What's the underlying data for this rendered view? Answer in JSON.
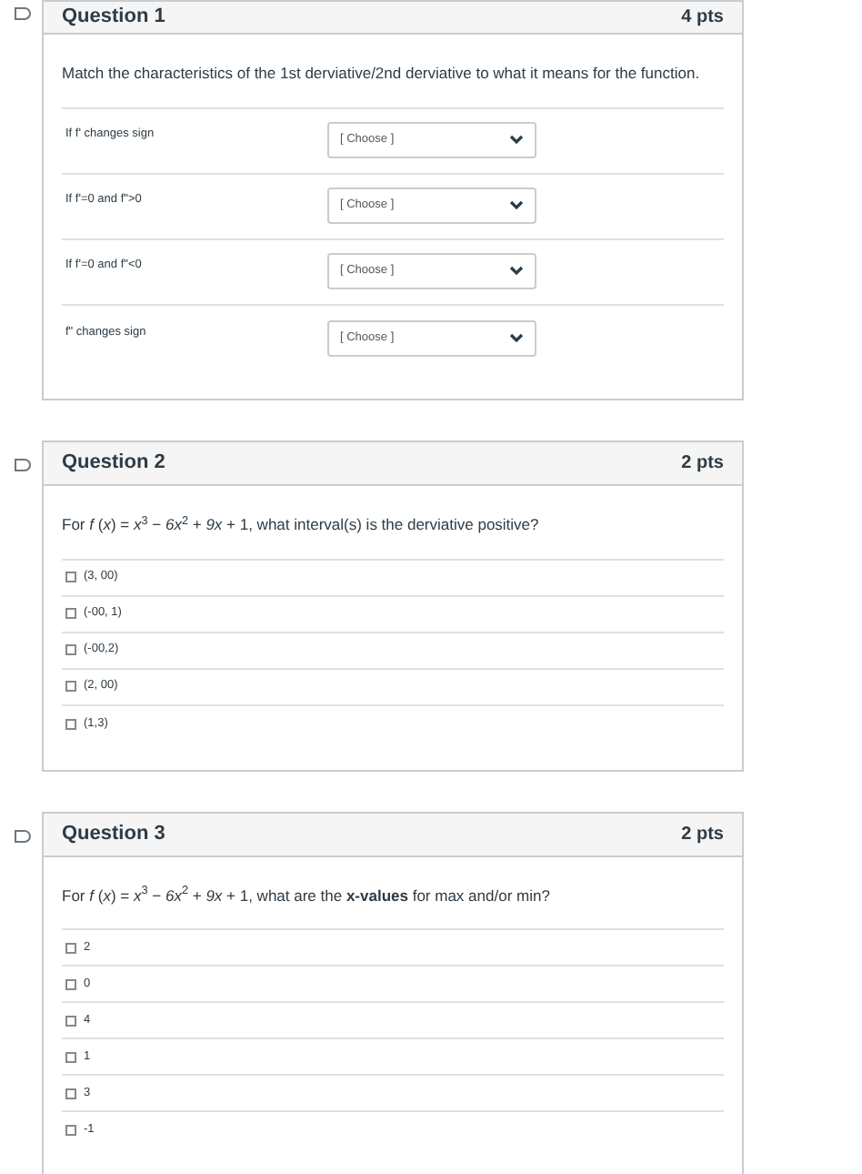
{
  "questions": [
    {
      "kind": "matching",
      "title": "Question 1",
      "points": "4 pts",
      "flagged": false,
      "prompt": "Match the characteristics of the 1st derviative/2nd derviative to what it means for the function.",
      "items": [
        {
          "label": "If f' changes sign",
          "choice": "[ Choose ]"
        },
        {
          "label": "If f'=0 and f\">0",
          "choice": "[ Choose ]"
        },
        {
          "label": "If f'=0 and f\"<0",
          "choice": "[ Choose ]"
        },
        {
          "label": "f\" changes sign",
          "choice": "[ Choose ]"
        }
      ]
    },
    {
      "kind": "multiple_answer",
      "title": "Question 2",
      "points": "2 pts",
      "flagged": false,
      "prompt": "For *f* (*x*) = *x*$^{3}$ − *6x*$^{2}$ + *9x* + 1, what interval(s) is the derviative positive?",
      "options": [
        {
          "label": "(3, 00)",
          "checked": false
        },
        {
          "label": "(-00, 1)",
          "checked": false
        },
        {
          "label": "(-00,2)",
          "checked": false
        },
        {
          "label": "(2, 00)",
          "checked": false
        },
        {
          "label": "(1,3)",
          "checked": false
        }
      ]
    },
    {
      "kind": "multiple_answer",
      "title": "Question 3",
      "points": "2 pts",
      "flagged": false,
      "prompt": "For *f* (*x*) = *x*$^{3}$ − *6x*$^{2}$ + *9x* + 1, what are the **x-values** for max and/or min?",
      "options": [
        {
          "label": "2",
          "checked": false
        },
        {
          "label": "0",
          "checked": false
        },
        {
          "label": "4",
          "checked": false
        },
        {
          "label": "1",
          "checked": false
        },
        {
          "label": "3",
          "checked": false
        },
        {
          "label": "-1",
          "checked": false
        }
      ]
    }
  ]
}
